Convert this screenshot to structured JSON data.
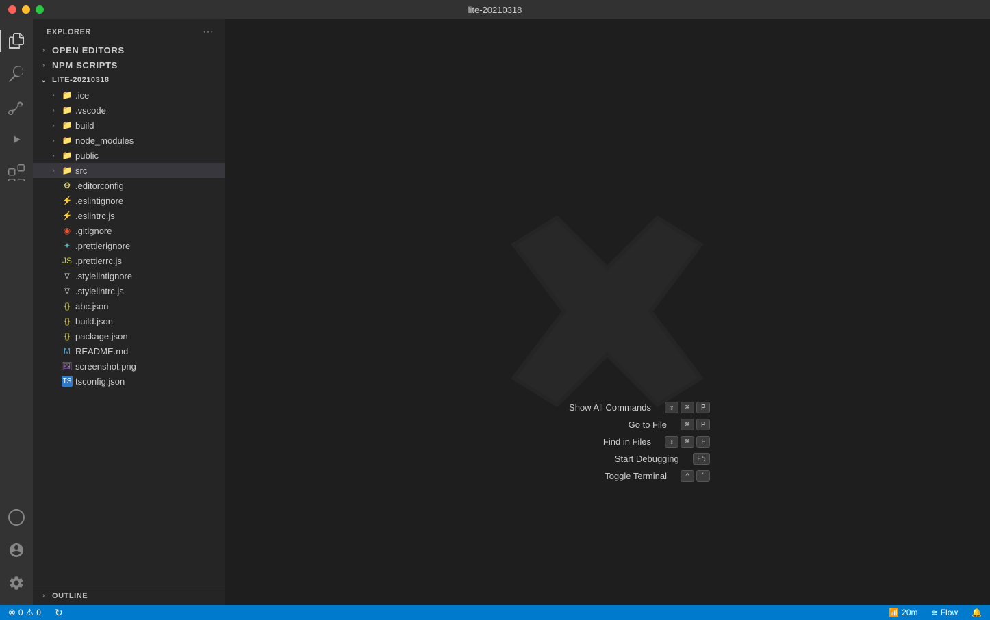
{
  "titlebar": {
    "title": "lite-20210318"
  },
  "activitybar": {
    "icons": [
      {
        "name": "explorer-icon",
        "label": "Explorer",
        "active": true,
        "symbol": "📁"
      },
      {
        "name": "search-icon",
        "label": "Search",
        "active": false
      },
      {
        "name": "source-control-icon",
        "label": "Source Control",
        "active": false
      },
      {
        "name": "run-icon",
        "label": "Run and Debug",
        "active": false
      },
      {
        "name": "extensions-icon",
        "label": "Extensions",
        "active": false
      },
      {
        "name": "remote-icon",
        "label": "Remote Explorer",
        "active": false
      }
    ]
  },
  "sidebar": {
    "header": "Explorer",
    "more_label": "···",
    "sections": {
      "open_editors": "OPEN EDITORS",
      "npm_scripts": "NPM SCRIPTS",
      "root": "LITE-20210318",
      "outline": "OUTLINE"
    },
    "tree": [
      {
        "id": "ice",
        "label": ".ice",
        "type": "folder",
        "indent": 1,
        "collapsed": true
      },
      {
        "id": "vscode",
        "label": ".vscode",
        "type": "folder",
        "indent": 1,
        "collapsed": true
      },
      {
        "id": "build",
        "label": "build",
        "type": "folder",
        "indent": 1,
        "collapsed": true
      },
      {
        "id": "node_modules",
        "label": "node_modules",
        "type": "folder",
        "indent": 1,
        "collapsed": true
      },
      {
        "id": "public",
        "label": "public",
        "type": "folder",
        "indent": 1,
        "collapsed": true
      },
      {
        "id": "src",
        "label": "src",
        "type": "folder",
        "indent": 1,
        "collapsed": true,
        "selected": true
      },
      {
        "id": "editorconfig",
        "label": ".editorconfig",
        "type": "editorconfig",
        "indent": 1
      },
      {
        "id": "eslintignore",
        "label": ".eslintignore",
        "type": "eslint",
        "indent": 1
      },
      {
        "id": "eslintrc",
        "label": ".eslintrc.js",
        "type": "js",
        "indent": 1
      },
      {
        "id": "gitignore",
        "label": ".gitignore",
        "type": "git",
        "indent": 1
      },
      {
        "id": "prettierignore",
        "label": ".prettierignore",
        "type": "prettier",
        "indent": 1
      },
      {
        "id": "prettierrc",
        "label": ".prettierrc.js",
        "type": "js-prettier",
        "indent": 1
      },
      {
        "id": "stylelintignore",
        "label": ".stylelintignore",
        "type": "stylelint",
        "indent": 1
      },
      {
        "id": "stylelintrc",
        "label": ".stylelintrc.js",
        "type": "stylelint-js",
        "indent": 1
      },
      {
        "id": "abc",
        "label": "abc.json",
        "type": "json",
        "indent": 1
      },
      {
        "id": "build-json",
        "label": "build.json",
        "type": "json",
        "indent": 1
      },
      {
        "id": "package",
        "label": "package.json",
        "type": "json",
        "indent": 1
      },
      {
        "id": "readme",
        "label": "README.md",
        "type": "md",
        "indent": 1
      },
      {
        "id": "screenshot",
        "label": "screenshot.png",
        "type": "png",
        "indent": 1
      },
      {
        "id": "tsconfig",
        "label": "tsconfig.json",
        "type": "ts-json",
        "indent": 1
      }
    ]
  },
  "welcome": {
    "commands": [
      {
        "label": "Show All Commands",
        "keys": [
          "⇧",
          "⌘",
          "P"
        ]
      },
      {
        "label": "Go to File",
        "keys": [
          "⌘",
          "P"
        ]
      },
      {
        "label": "Find in Files",
        "keys": [
          "⇧",
          "⌘",
          "F"
        ]
      },
      {
        "label": "Start Debugging",
        "keys": [
          "F5"
        ]
      },
      {
        "label": "Toggle Terminal",
        "keys": [
          "⌃",
          "`"
        ]
      }
    ]
  },
  "statusbar": {
    "left": [
      {
        "name": "errors",
        "icon": "⊗",
        "value": "0"
      },
      {
        "name": "warnings",
        "icon": "⚠",
        "value": "0"
      },
      {
        "name": "sync",
        "icon": "↻",
        "value": ""
      }
    ],
    "right": [
      {
        "name": "remote",
        "icon": "📡",
        "value": "20m"
      },
      {
        "name": "flow",
        "value": "Flow"
      },
      {
        "name": "notifications",
        "icon": "🔔",
        "value": ""
      }
    ]
  }
}
